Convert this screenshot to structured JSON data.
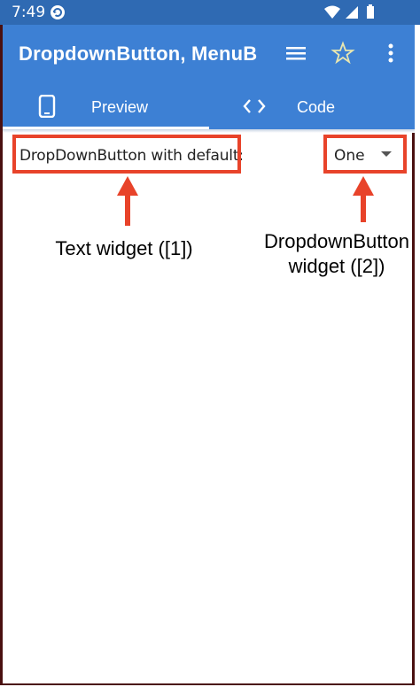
{
  "status_bar": {
    "time": "7:49",
    "icons": [
      "sync-icon",
      "wifi-icon",
      "cell-signal-icon",
      "battery-icon"
    ]
  },
  "app_bar": {
    "title": "DropdownButton, MenuBu",
    "actions": [
      "menu-icon",
      "star-icon",
      "more-vert-icon"
    ],
    "color": "#3d80d4"
  },
  "tabs": [
    {
      "label": "Preview",
      "icon": "phone-icon",
      "selected": true
    },
    {
      "label": "Code",
      "icon": "code-icon",
      "selected": false
    }
  ],
  "preview": {
    "text_widget": "DropDownButton with default:",
    "dropdown_value": "One"
  },
  "annotations": {
    "text_label": "Text widget ([1])",
    "dropdown_label_line1": "DropdownButton",
    "dropdown_label_line2": "widget ([2])",
    "highlight_color": "#e8432a"
  }
}
